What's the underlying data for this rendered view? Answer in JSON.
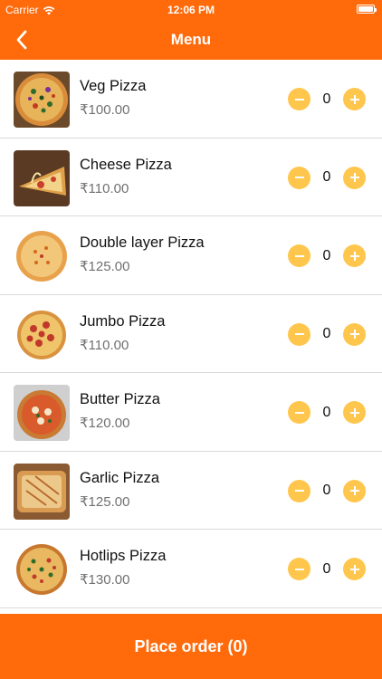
{
  "status_bar": {
    "carrier": "Carrier",
    "time": "12:06 PM"
  },
  "nav": {
    "title": "Menu"
  },
  "colors": {
    "brand": "#ff6a0a",
    "stepper": "#ffc64d"
  },
  "menu": {
    "items": [
      {
        "name": "Veg Pizza",
        "price": "₹100.00",
        "quantity": "0",
        "image": "veg-pizza-photo"
      },
      {
        "name": "Cheese Pizza",
        "price": "₹110.00",
        "quantity": "0",
        "image": "cheese-pizza-photo"
      },
      {
        "name": "Double layer Pizza",
        "price": "₹125.00",
        "quantity": "0",
        "image": "double-layer-pizza-photo"
      },
      {
        "name": "Jumbo Pizza",
        "price": "₹110.00",
        "quantity": "0",
        "image": "jumbo-pizza-photo"
      },
      {
        "name": "Butter Pizza",
        "price": "₹120.00",
        "quantity": "0",
        "image": "butter-pizza-photo"
      },
      {
        "name": "Garlic Pizza",
        "price": "₹125.00",
        "quantity": "0",
        "image": "garlic-pizza-photo"
      },
      {
        "name": "Hotlips Pizza",
        "price": "₹130.00",
        "quantity": "0",
        "image": "hotlips-pizza-photo"
      }
    ]
  },
  "footer": {
    "place_order_label": "Place order (0)"
  }
}
